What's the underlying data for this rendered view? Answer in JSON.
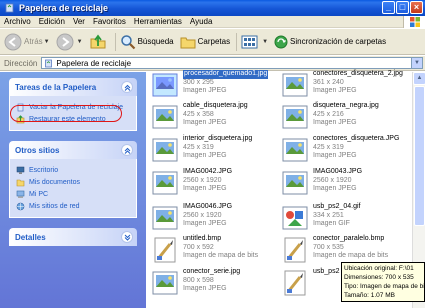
{
  "window": {
    "title": "Papelera de reciclaje"
  },
  "menu": [
    "Archivo",
    "Edición",
    "Ver",
    "Favoritos",
    "Herramientas",
    "Ayuda"
  ],
  "toolbar": {
    "back_label": "Atrás",
    "search_label": "Búsqueda",
    "folders_label": "Carpetas",
    "sync_label": "Sincronización de carpetas"
  },
  "address": {
    "label": "Dirección",
    "value": "Papelera de reciclaje"
  },
  "taskpane": {
    "recycle_tasks": {
      "title": "Tareas de la Papelera",
      "items": [
        "Vaciar la Papelera de reciclaje",
        "Restaurar este elemento"
      ]
    },
    "other_places": {
      "title": "Otros sitios",
      "items": [
        "Escritorio",
        "Mis documentos",
        "Mi PC",
        "Mis sitios de red"
      ]
    },
    "details": {
      "title": "Detalles"
    }
  },
  "files": [
    {
      "name": "procesador_quemado1.jpg",
      "dims": "300 x 295",
      "type": "Imagen JPEG",
      "kind": "jpg",
      "selected": true
    },
    {
      "name": "conectores_disquetera_2.jpg",
      "dims": "361 x 240",
      "type": "Imagen JPEG",
      "kind": "jpg"
    },
    {
      "name": "cable_disquetera.jpg",
      "dims": "425 x 358",
      "type": "Imagen JPEG",
      "kind": "jpg"
    },
    {
      "name": "disquetera_negra.jpg",
      "dims": "425 x 216",
      "type": "Imagen JPEG",
      "kind": "jpg"
    },
    {
      "name": "interior_disquetera.jpg",
      "dims": "425 x 319",
      "type": "Imagen JPEG",
      "kind": "jpg"
    },
    {
      "name": "conectores_disquetera.JPG",
      "dims": "425 x 319",
      "type": "Imagen JPEG",
      "kind": "jpg"
    },
    {
      "name": "IMAG0042.JPG",
      "dims": "2560 x 1920",
      "type": "Imagen JPEG",
      "kind": "jpg"
    },
    {
      "name": "IMAG0043.JPG",
      "dims": "2560 x 1920",
      "type": "Imagen JPEG",
      "kind": "jpg"
    },
    {
      "name": "IMAG0046.JPG",
      "dims": "2560 x 1920",
      "type": "Imagen JPEG",
      "kind": "jpg"
    },
    {
      "name": "usb_ps2_04.gif",
      "dims": "334 x 251",
      "type": "Imagen GIF",
      "kind": "gif"
    },
    {
      "name": "untitled.bmp",
      "dims": "700 x 592",
      "type": "Imagen de mapa de bits",
      "kind": "bmp"
    },
    {
      "name": "conector_paralelo.bmp",
      "dims": "700 x 535",
      "type": "Imagen de mapa de bits",
      "kind": "bmp"
    },
    {
      "name": "conector_serie.jpg",
      "dims": "800 x 598",
      "type": "Imagen JPEG",
      "kind": "jpg"
    },
    {
      "name": "usb_ps2",
      "dims": "",
      "type": "",
      "kind": "bmp"
    }
  ],
  "tooltip": {
    "line1": "Ubicación original: F:\\01",
    "line2": "Dimensiones: 700 x 535",
    "line3": "Tipo: Imagen de mapa de bi",
    "line4": "Tamaño: 1.07 MB"
  }
}
